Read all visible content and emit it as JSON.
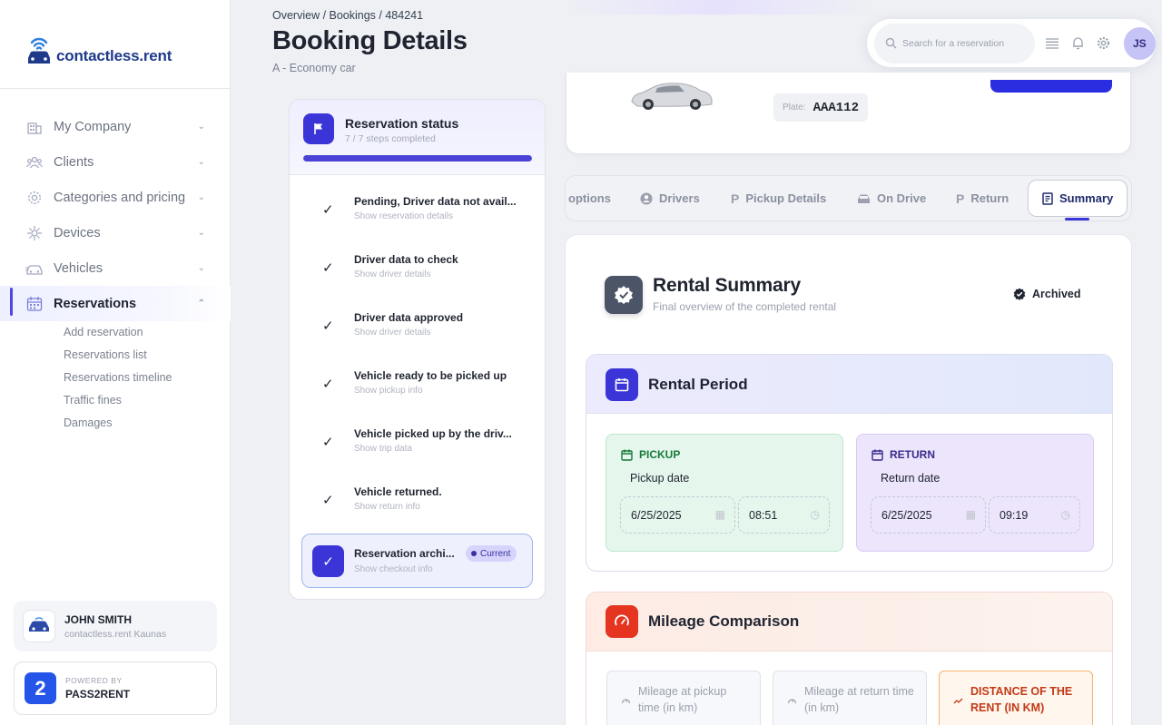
{
  "brand": {
    "name": "contactless.rent"
  },
  "sidebar": {
    "items": [
      {
        "label": "My Company"
      },
      {
        "label": "Clients"
      },
      {
        "label": "Categories and pricing"
      },
      {
        "label": "Devices"
      },
      {
        "label": "Vehicles"
      },
      {
        "label": "Reservations"
      }
    ],
    "subitems": [
      {
        "label": "Add reservation"
      },
      {
        "label": "Reservations list"
      },
      {
        "label": "Reservations timeline"
      },
      {
        "label": "Traffic fines"
      },
      {
        "label": "Damages"
      }
    ],
    "user": {
      "name": "JOHN SMITH",
      "company": "contactless.rent Kaunas"
    },
    "powered": {
      "label": "POWERED BY",
      "name": "PASS2RENT"
    }
  },
  "header": {
    "breadcrumb": "Overview / Bookings / 484241",
    "title": "Booking Details",
    "subtitle": "A - Economy car",
    "search_placeholder": "Search for a reservation",
    "avatar_initials": "JS"
  },
  "status": {
    "title": "Reservation status",
    "steps_text": "7 / 7 steps completed",
    "progress": 1.0,
    "steps": [
      {
        "title": "Pending, Driver data not avail...",
        "sub": "Show reservation details"
      },
      {
        "title": "Driver data to check",
        "sub": "Show driver details"
      },
      {
        "title": "Driver data approved",
        "sub": "Show driver details"
      },
      {
        "title": "Vehicle ready to be picked up",
        "sub": "Show pickup info"
      },
      {
        "title": "Vehicle picked up by the driv...",
        "sub": "Show trip data"
      },
      {
        "title": "Vehicle returned.",
        "sub": "Show return info"
      },
      {
        "title": "Reservation archi...",
        "sub": "Show checkout info",
        "badge": "Current"
      }
    ]
  },
  "vehicle": {
    "plate_label": "Plate:",
    "plate": "AAA112"
  },
  "tabs": [
    {
      "label": "options"
    },
    {
      "label": "Drivers"
    },
    {
      "label": "Pickup Details"
    },
    {
      "label": "On Drive"
    },
    {
      "label": "Return"
    },
    {
      "label": "Summary"
    }
  ],
  "summary": {
    "title": "Rental Summary",
    "subtitle": "Final overview of the completed rental",
    "status": "Archived",
    "period": {
      "title": "Rental Period",
      "pickup": {
        "label": "PICKUP",
        "sub": "Pickup date",
        "date": "6/25/2025",
        "time": "08:51"
      },
      "return": {
        "label": "RETURN",
        "sub": "Return date",
        "date": "6/25/2025",
        "time": "09:19"
      }
    },
    "mileage": {
      "title": "Mileage Comparison",
      "pickup_label": "Mileage at pickup time (in km)",
      "return_label": "Mileage at return time (in km)",
      "distance_label": "DISTANCE OF THE RENT (IN KM)"
    }
  },
  "colors": {
    "accent": "#3b35d8",
    "pickup_bg": "#e5f6ec",
    "return_bg": "#ece5fb",
    "mileage_icon": "#e5341f"
  }
}
